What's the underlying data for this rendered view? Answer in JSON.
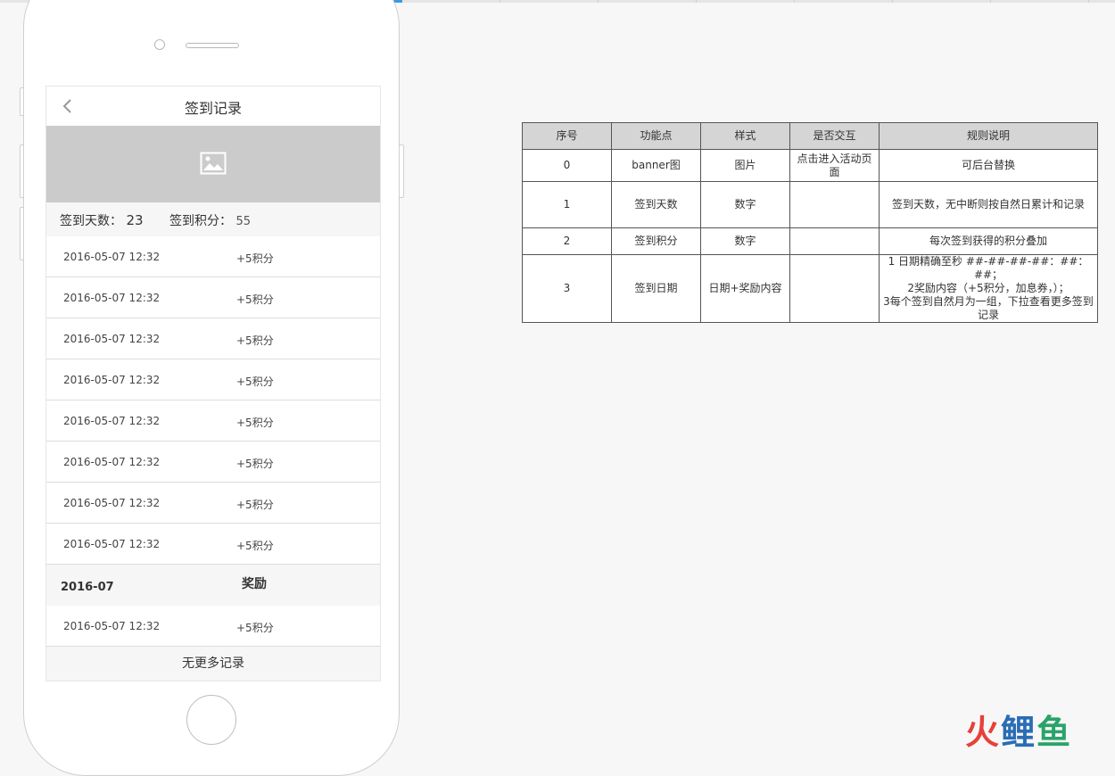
{
  "phone": {
    "nav_title": "签到记录",
    "stats": {
      "days_label": "签到天数：",
      "days_value": "23",
      "points_label": "签到积分：",
      "points_value": "55"
    },
    "records": [
      {
        "date": "2016-05-07 12:32",
        "points": "+5积分"
      },
      {
        "date": "2016-05-07 12:32",
        "points": "+5积分"
      },
      {
        "date": "2016-05-07 12:32",
        "points": "+5积分"
      },
      {
        "date": "2016-05-07 12:32",
        "points": "+5积分"
      },
      {
        "date": "2016-05-07 12:32",
        "points": "+5积分"
      },
      {
        "date": "2016-05-07 12:32",
        "points": "+5积分"
      },
      {
        "date": "2016-05-07 12:32",
        "points": "+5积分"
      },
      {
        "date": "2016-05-07 12:32",
        "points": "+5积分"
      }
    ],
    "month_header": {
      "month": "2016-07",
      "reward": "奖励"
    },
    "extra_record": {
      "date": "2016-05-07 12:32",
      "points": "+5积分"
    },
    "footer": "无更多记录"
  },
  "spec_table": {
    "headers": [
      "序号",
      "功能点",
      "样式",
      "是否交互",
      "规则说明"
    ],
    "rows": [
      {
        "no": "0",
        "feature": "banner图",
        "style": "图片",
        "interaction": "点击进入活动页面",
        "rule": [
          "可后台替换"
        ]
      },
      {
        "no": "1",
        "feature": "签到天数",
        "style": "数字",
        "interaction": "",
        "rule": [
          "签到天数，无中断则按自然日累计和记录"
        ]
      },
      {
        "no": "2",
        "feature": "签到积分",
        "style": "数字",
        "interaction": "",
        "rule": [
          "每次签到获得的积分叠加"
        ]
      },
      {
        "no": "3",
        "feature": "签到日期",
        "style": "日期+奖励内容",
        "interaction": "",
        "rule": [
          "1 日期精确至秒 ##-##-##-##：##：##；",
          "2奖励内容（+5积分，加息券，）；",
          "3每个签到自然月为一组，下拉查看更多签到记录"
        ]
      }
    ]
  },
  "watermark": {
    "part1": "火",
    "part2": "鲤",
    "part3": "鱼"
  },
  "colors": {
    "accent": "#3b9be0",
    "banner_gray": "#cbcbcb"
  }
}
